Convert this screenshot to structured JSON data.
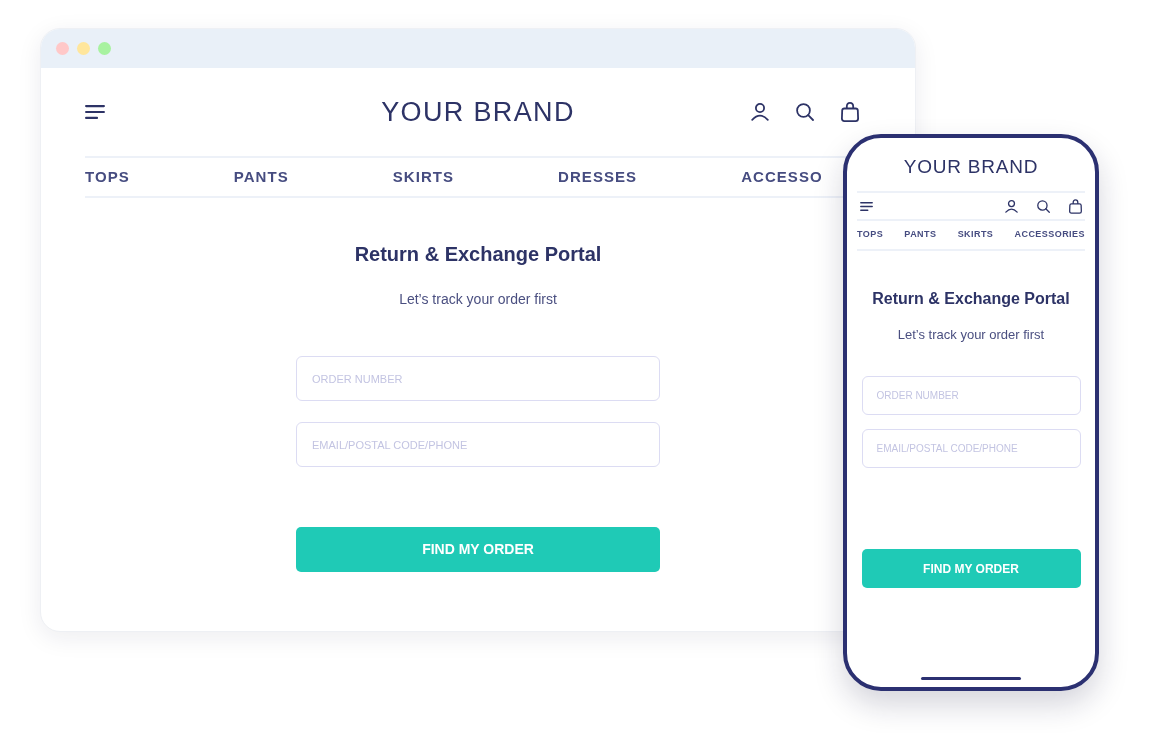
{
  "browser_window": {
    "window_dots": [
      {
        "color": "#ffc8c8"
      },
      {
        "color": "#ffe69c"
      },
      {
        "color": "#a8f2a0"
      }
    ],
    "brand": "YOUR BRAND",
    "nav": [
      "TOPS",
      "PANTS",
      "SKIRTS",
      "DRESSES",
      "ACCESSO"
    ],
    "heading": "Return & Exchange Portal",
    "subheading": "Let’s track your order first",
    "fields": [
      {
        "placeholder": "ORDER NUMBER"
      },
      {
        "placeholder": "EMAIL/POSTAL CODE/PHONE"
      }
    ],
    "button": "FIND MY ORDER"
  },
  "phone": {
    "brand": "YOUR BRAND",
    "nav": [
      "TOPS",
      "PANTS",
      "SKIRTS",
      "ACCESSORIES"
    ],
    "heading": "Return & Exchange Portal",
    "subheading": "Let’s track your order first",
    "fields": [
      {
        "placeholder": "ORDER NUMBER"
      },
      {
        "placeholder": "EMAIL/POSTAL CODE/PHONE"
      }
    ],
    "button": "FIND MY ORDER"
  }
}
